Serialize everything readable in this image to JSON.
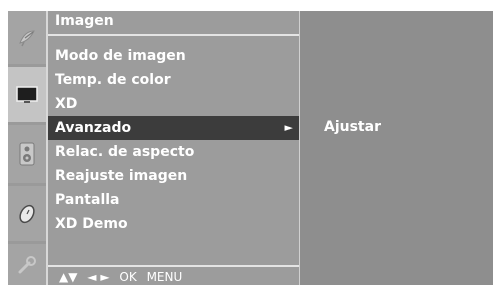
{
  "menu": {
    "title": "Imagen",
    "items": [
      {
        "label": "Modo de imagen"
      },
      {
        "label": "Temp. de color"
      },
      {
        "label": "XD"
      },
      {
        "label": "Avanzado",
        "selected": true
      },
      {
        "label": "Relac. de aspecto"
      },
      {
        "label": "Reajuste imagen"
      },
      {
        "label": "Pantalla"
      },
      {
        "label": "XD Demo"
      }
    ],
    "selected_arrow": "►",
    "footer": {
      "nav_up_down": "▲▼",
      "nav_left_right": "◄ ►",
      "ok": "OK",
      "menu": "MENU"
    }
  },
  "submenu": {
    "items": [
      {
        "label": "Ajustar"
      }
    ]
  },
  "icons": [
    "satellite-dish-icon",
    "picture-tv-icon",
    "speaker-icon",
    "clock-icon",
    "wrench-icon"
  ],
  "colors": {
    "panel": "#9c9c9c",
    "selected_row": "#3c3c3c",
    "text": "#ffffff"
  }
}
